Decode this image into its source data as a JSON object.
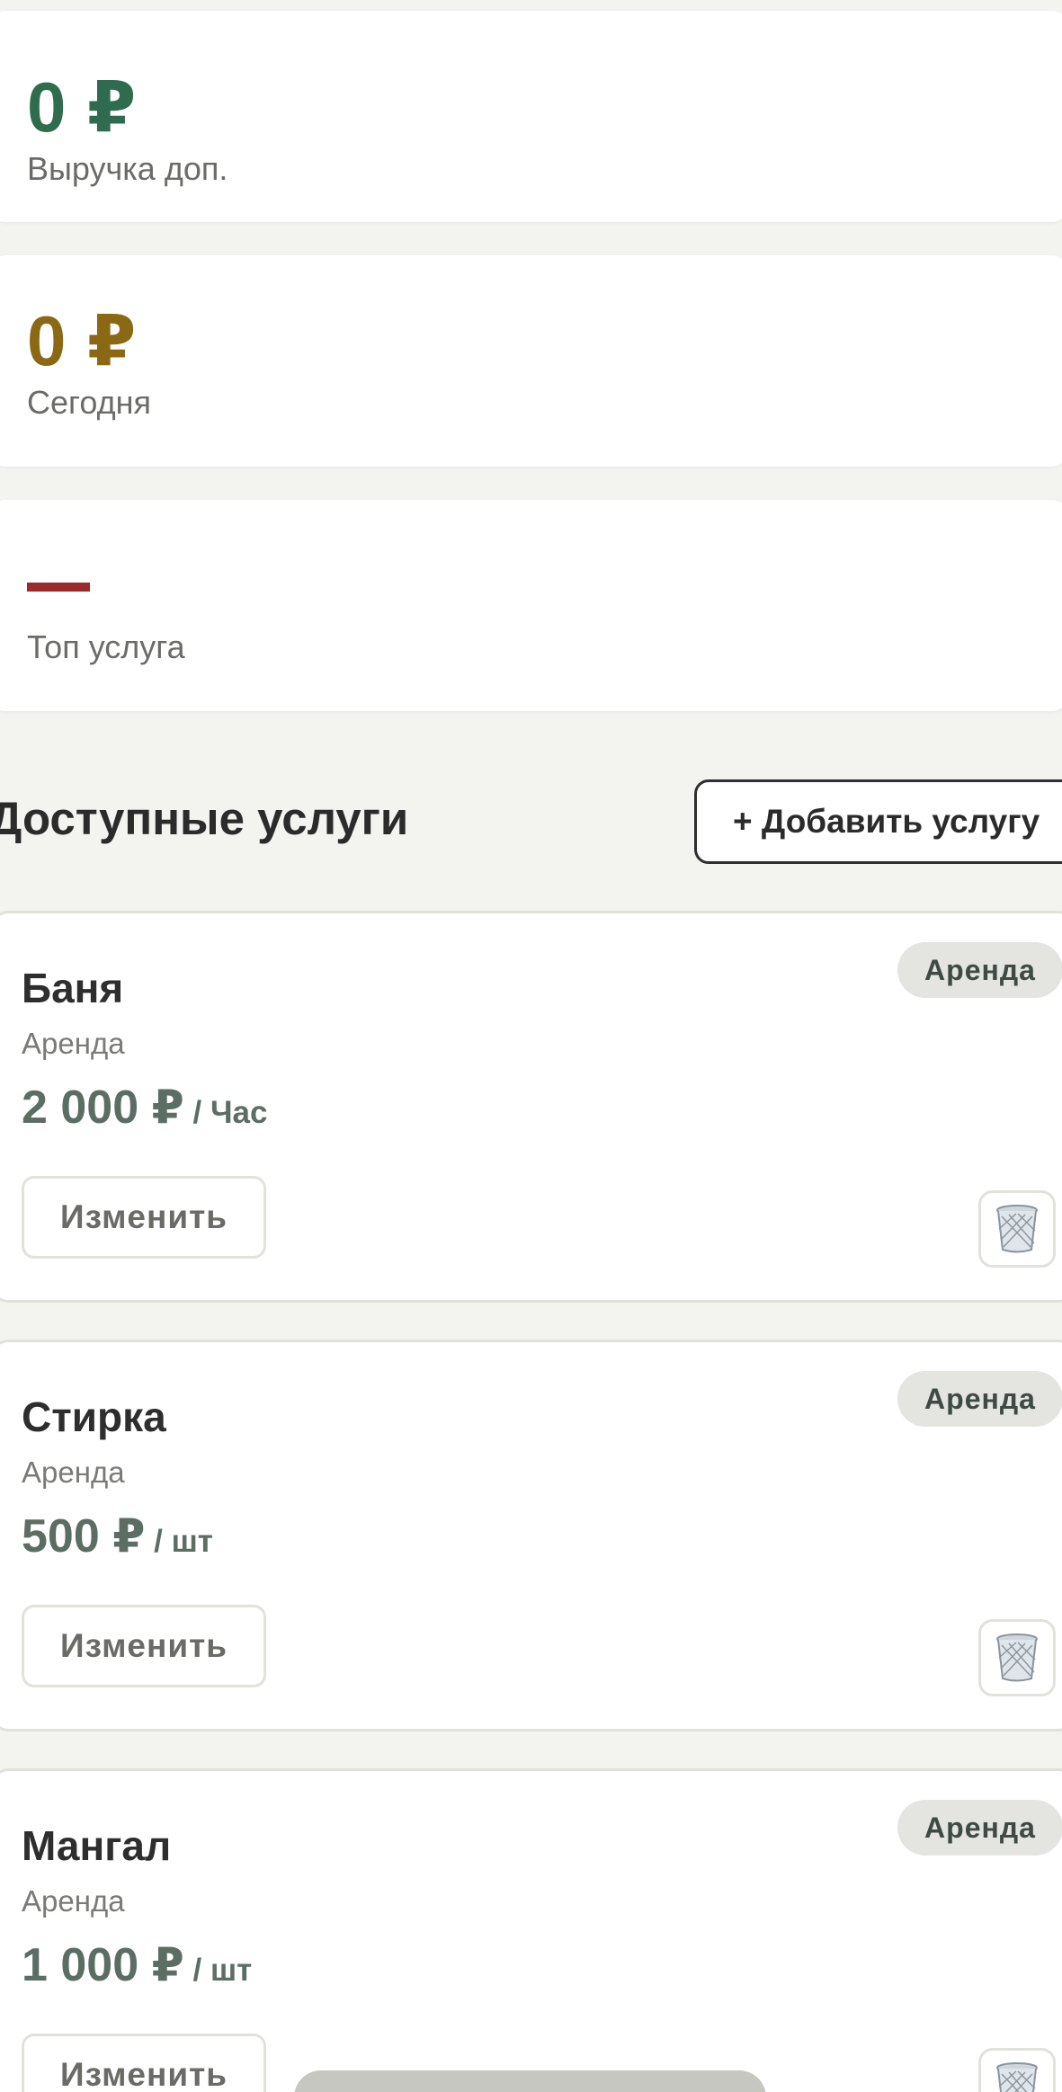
{
  "stats": [
    {
      "value": "0 ₽",
      "label": "Выручка доп.",
      "color": "#2f6b4f"
    },
    {
      "value": "0 ₽",
      "label": "Сегодня",
      "color": "#8b6914"
    },
    {
      "value": "",
      "label": "Топ услуга",
      "color": "#9c2a2a"
    }
  ],
  "services_section": {
    "title": "Доступные услуги",
    "add_button": "+ Добавить услугу"
  },
  "services": [
    {
      "name": "Баня",
      "category": "Аренда",
      "badge": "Аренда",
      "price": "2 000 ₽",
      "unit": " / Час",
      "edit_label": "Изменить",
      "delete_icon": "trash-icon"
    },
    {
      "name": "Стирка",
      "category": "Аренда",
      "badge": "Аренда",
      "price": "500 ₽",
      "unit": " / шт",
      "edit_label": "Изменить",
      "delete_icon": "trash-icon"
    },
    {
      "name": "Мангал",
      "category": "Аренда",
      "badge": "Аренда",
      "price": "1 000 ₽",
      "unit": " / шт",
      "edit_label": "Изменить",
      "delete_icon": "trash-icon"
    }
  ]
}
